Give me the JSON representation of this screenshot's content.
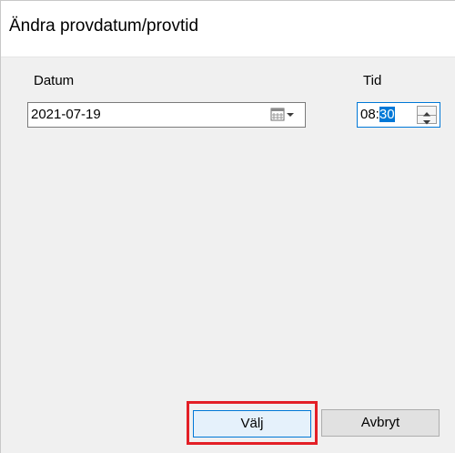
{
  "dialog": {
    "title": "Ändra provdatum/provtid"
  },
  "form": {
    "date_label": "Datum",
    "date_value": "2021-07-19",
    "time_label": "Tid",
    "time_hours": "08:",
    "time_minutes": "30"
  },
  "buttons": {
    "ok_label": "Välj",
    "cancel_label": "Avbryt"
  },
  "colors": {
    "accent": "#0078d7",
    "highlight": "#e31f26"
  },
  "icons": {
    "calendar": "calendar-dropdown-icon",
    "spin_up": "spin-up-icon",
    "spin_down": "spin-down-icon"
  }
}
